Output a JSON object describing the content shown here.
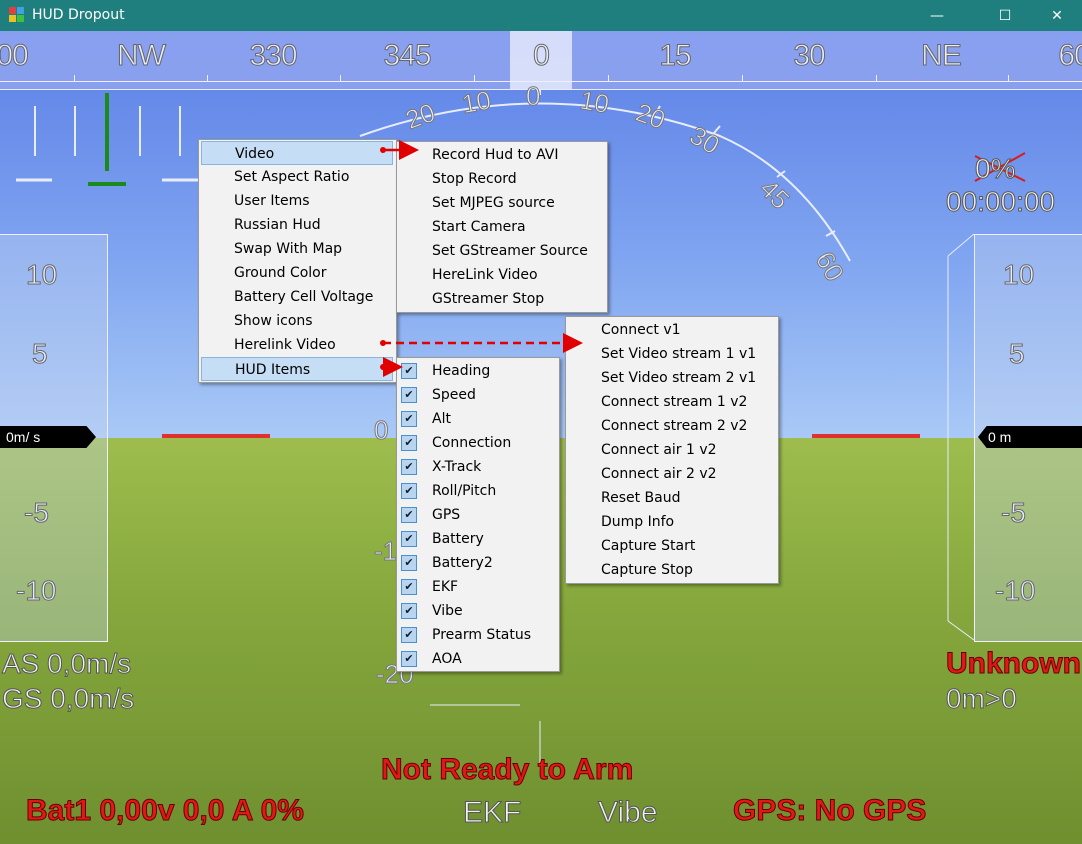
{
  "window": {
    "title": "HUD Dropout",
    "minimize_glyph": "—",
    "maximize_glyph": "☐",
    "close_glyph": "✕"
  },
  "heading_tape": {
    "labels": [
      "00",
      "NW",
      "330",
      "345",
      "0",
      "15",
      "30",
      "NE",
      "60"
    ]
  },
  "roll_scale": {
    "labels": [
      "20",
      "10",
      "0",
      "10",
      "20",
      "30",
      "45",
      "60"
    ]
  },
  "pitch_labels": {
    "zero": "0",
    "minus_10": "-1",
    "minus_20": "-20"
  },
  "speed_tape": {
    "labels": [
      "10",
      "5",
      "-5",
      "-10"
    ],
    "readout": "0m/ s"
  },
  "alt_tape": {
    "labels": [
      "10",
      "5",
      "-5",
      "-10"
    ],
    "readout": "0 m"
  },
  "top_right": {
    "battery_pct": "0%",
    "timer": "00:00:00"
  },
  "left_info": {
    "airspeed": "AS 0,0m/s",
    "groundspeed": "GS 0,0m/s"
  },
  "right_info": {
    "mode": "Unknown",
    "distance": "0m>0"
  },
  "bottom": {
    "arm_status": "Not Ready to Arm",
    "battery": "Bat1 0,00v 0,0 A 0%",
    "ekf": "EKF",
    "vibe": "Vibe",
    "gps": "GPS: No GPS"
  },
  "main_menu": {
    "items": [
      "Video",
      "Set Aspect Ratio",
      "User Items",
      "Russian Hud",
      "Swap With Map",
      "Ground Color",
      "Battery Cell Voltage",
      "Show icons",
      "Herelink Video",
      "HUD Items"
    ]
  },
  "video_menu": {
    "items": [
      "Record Hud to AVI",
      "Stop Record",
      "Set MJPEG source",
      "Start Camera",
      "Set GStreamer Source",
      "HereLink Video",
      "GStreamer Stop"
    ]
  },
  "herelink_menu": {
    "items": [
      "Connect v1",
      "Set Video stream 1 v1",
      "Set Video stream 2 v1",
      "Connect stream 1 v2",
      "Connect stream 2 v2",
      "Connect air 1 v2",
      "Connect air 2 v2",
      "Reset Baud",
      "Dump Info",
      "Capture Start",
      "Capture Stop"
    ]
  },
  "hud_items_menu": {
    "items": [
      "Heading",
      "Speed",
      "Alt",
      "Connection",
      "X-Track",
      "Roll/Pitch",
      "GPS",
      "Battery",
      "Battery2",
      "EKF",
      "Vibe",
      "Prearm Status",
      "AOA"
    ],
    "check_glyph": "✔"
  },
  "colors": {
    "titlebar": "#1f7f7f",
    "sky": "#6f95ec",
    "ground": "#86a83d",
    "warning_red": "#e01818",
    "menu_highlight": "#c5ddf5",
    "arrow_red": "#e00000"
  }
}
